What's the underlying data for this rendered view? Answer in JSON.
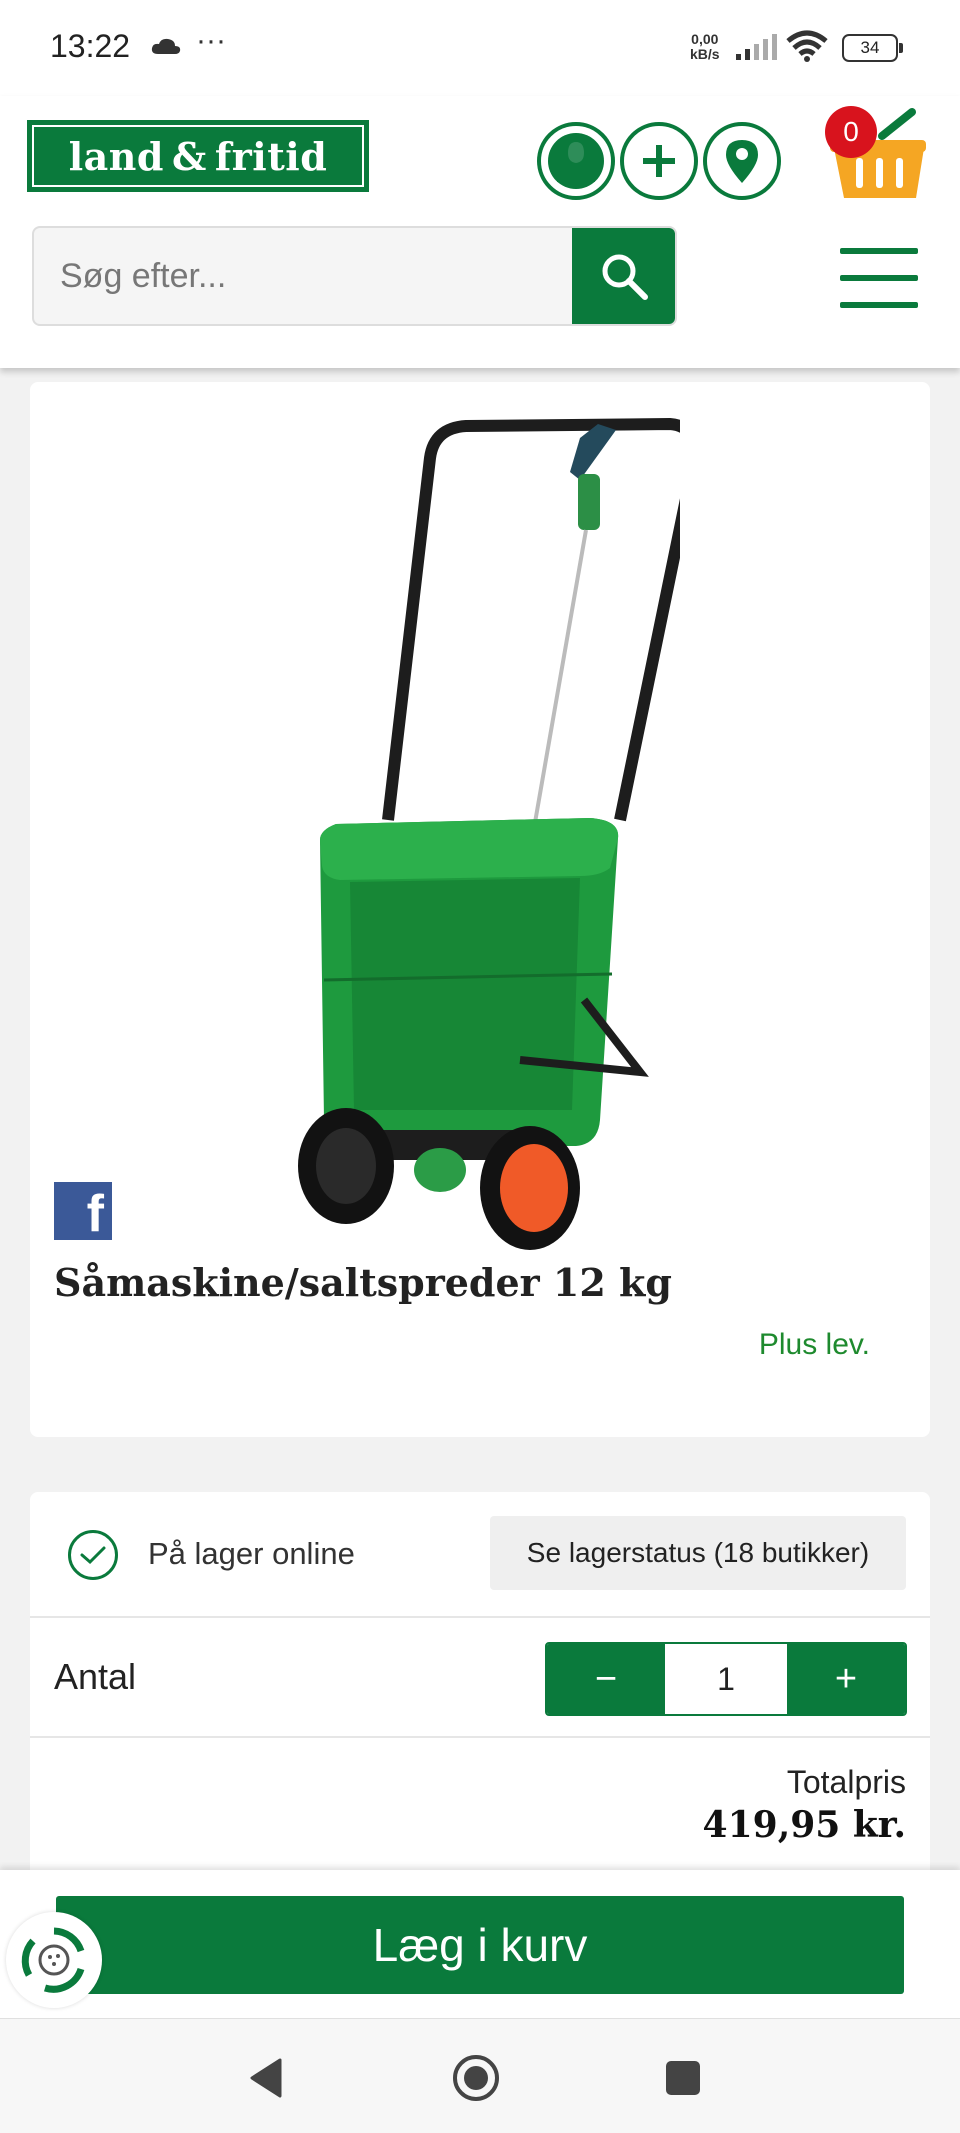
{
  "status_bar": {
    "time": "13:22",
    "dots": "···",
    "speed_value": "0,00",
    "speed_unit": "kB/s",
    "battery": "34"
  },
  "header": {
    "logo_text": "land & fritid",
    "cart_count": "0",
    "brand_color": "#0a7a3c",
    "badge_color": "#d8131d",
    "icons": [
      "user-icon",
      "plus-icon",
      "location-pin-icon",
      "basket-icon",
      "search-icon",
      "hamburger-menu-icon"
    ]
  },
  "search": {
    "placeholder": "Søg efter..."
  },
  "product": {
    "title": "Såmaskine/saltspreder 12 kg",
    "delivery_note": "Plus lev.",
    "share_icon": "facebook-icon"
  },
  "purchase": {
    "stock_text": "På lager online",
    "stock_button": "Se lagerstatus (18 butikker)",
    "qty_label": "Antal",
    "qty_minus": "−",
    "qty_value": "1",
    "qty_plus": "+",
    "total_label": "Totalpris",
    "total_price": "419,95 kr."
  },
  "actions": {
    "add_to_cart": "Læg i kurv"
  }
}
